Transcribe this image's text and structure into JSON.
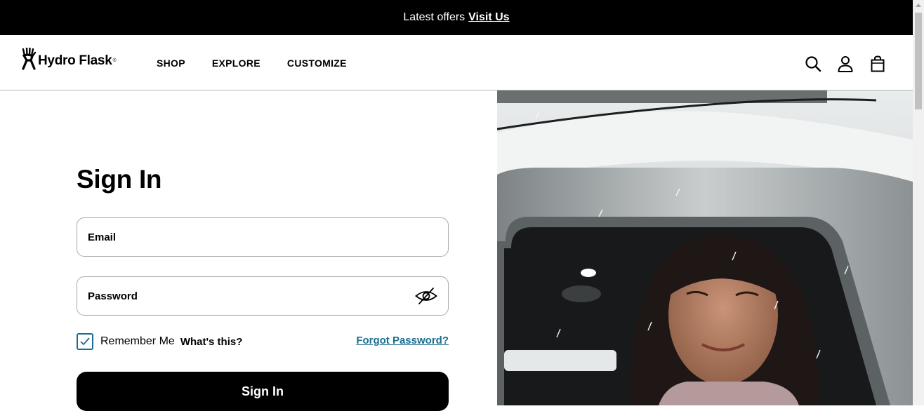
{
  "promo": {
    "text": "Latest offers",
    "link": "Visit Us"
  },
  "brand": {
    "name": "Hydro Flask",
    "mark": "®"
  },
  "nav": {
    "items": [
      "SHOP",
      "EXPLORE",
      "CUSTOMIZE"
    ]
  },
  "header_icons": [
    "search-icon",
    "account-icon",
    "bag-icon"
  ],
  "signin": {
    "title": "Sign In",
    "email_label": "Email",
    "password_label": "Password",
    "remember_label": "Remember Me",
    "remember_checked": true,
    "whats_this": "What's this?",
    "forgot": "Forgot Password?",
    "button": "Sign In"
  },
  "colors": {
    "accent": "#1b6e90",
    "promo_bg": "#000000",
    "button_bg": "#000000"
  }
}
